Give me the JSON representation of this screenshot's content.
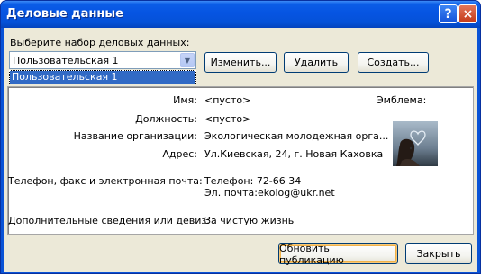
{
  "window": {
    "title": "Деловые данные",
    "help_icon": "?",
    "close_icon": "×"
  },
  "selector": {
    "label": "Выберите набор деловых данных:",
    "selected": "Пользовательская 1",
    "options": [
      "Пользовательская 1"
    ]
  },
  "buttons": {
    "edit": "Изменить...",
    "delete": "Удалить",
    "create": "Создать...",
    "update": "Обновить публикацию",
    "close": "Закрыть"
  },
  "details": {
    "name_label": "Имя:",
    "name_value": "<пусто>",
    "position_label": "Должность:",
    "position_value": "<пусто>",
    "org_label": "Название организации:",
    "org_value": "Экологическая молодежная орга...",
    "address_label": "Адрес:",
    "address_value": "Ул.Киевская, 24, г. Новая Каховка",
    "contacts_label": "Телефон, факс и электронная почта:",
    "phone_value": "Телефон: 72-66 34",
    "email_value": "Эл. почта:ekolog@ukr.net",
    "motto_label": "Дополнительные сведения или девиз:",
    "motto_value": "За чистую жизнь",
    "emblem_label": "Эмблема:"
  }
}
